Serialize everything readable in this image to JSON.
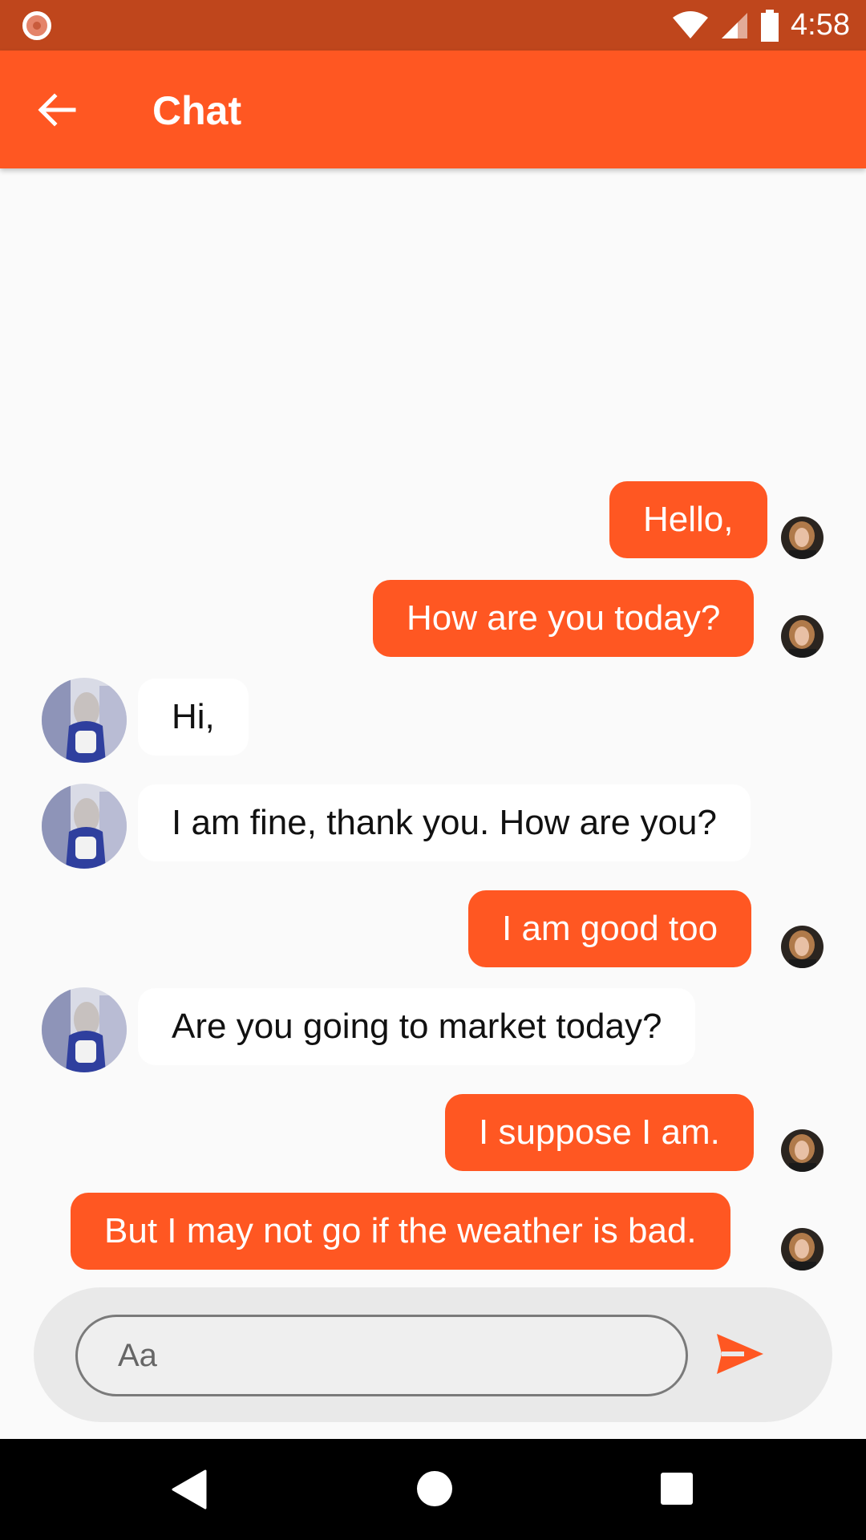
{
  "status_bar": {
    "time": "4:58",
    "icons": [
      "notification-dot-icon",
      "wifi-icon",
      "signal-icon",
      "battery-icon"
    ]
  },
  "app_bar": {
    "title": "Chat",
    "back_icon": "arrow-left-icon"
  },
  "messages": [
    {
      "direction": "outgoing",
      "text": "Hello,"
    },
    {
      "direction": "outgoing",
      "text": "How are you today?"
    },
    {
      "direction": "incoming",
      "text": "Hi,"
    },
    {
      "direction": "incoming",
      "text": "I am fine, thank you. How are you?"
    },
    {
      "direction": "outgoing",
      "text": "I am good too"
    },
    {
      "direction": "incoming",
      "text": "Are you going to market today?"
    },
    {
      "direction": "outgoing",
      "text": "I suppose I am."
    },
    {
      "direction": "outgoing",
      "text": "But I may not go if the weather is bad."
    }
  ],
  "composer": {
    "placeholder": "Aa",
    "value": "",
    "send_icon": "send-icon"
  },
  "nav_bar": {
    "icons": [
      "nav-back-icon",
      "nav-home-icon",
      "nav-recents-icon"
    ]
  },
  "colors": {
    "accent": "#ff5722",
    "status_bar": "#bf461c",
    "background": "#fafafa",
    "incoming_bubble": "#ffffff"
  }
}
